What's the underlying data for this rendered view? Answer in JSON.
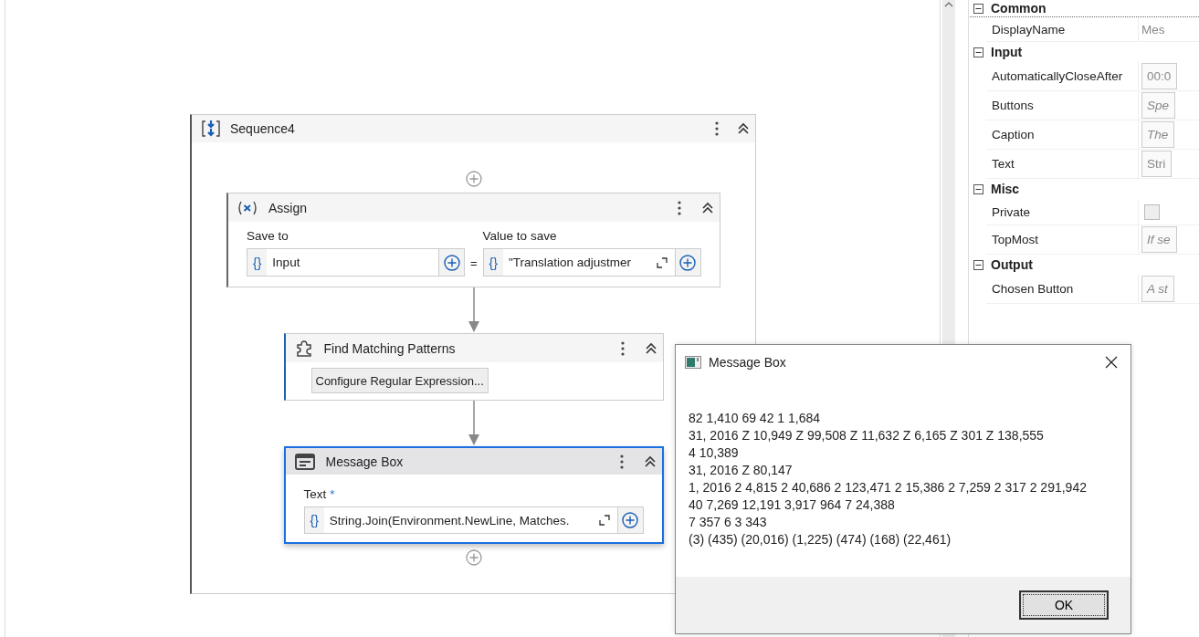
{
  "sequence": {
    "title": "Sequence4",
    "activities": [
      {
        "kind": "assign",
        "title": "Assign",
        "selected": false,
        "save_to_label": "Save to",
        "save_to_brace": "{}",
        "save_to_value": "Input",
        "equals": "=",
        "value_label": "Value to save",
        "value_brace": "{}",
        "value": "\"Translation adjustmer"
      },
      {
        "kind": "find",
        "title": "Find Matching Patterns",
        "selected": false,
        "button": "Configure Regular Expression..."
      },
      {
        "kind": "message",
        "title": "Message Box",
        "selected": true,
        "field_label": "Text",
        "required": "*",
        "brace": "{}",
        "value": "String.Join(Environment.NewLine, Matches."
      }
    ]
  },
  "properties": [
    {
      "name": "Common",
      "expanded": true,
      "rows": [
        {
          "label": "DisplayName",
          "kind": "plain",
          "value": "Mes"
        }
      ]
    },
    {
      "name": "Input",
      "expanded": true,
      "rows": [
        {
          "label": "AutomaticallyCloseAfter",
          "kind": "value",
          "value": "00:0"
        },
        {
          "label": "Buttons",
          "kind": "hint",
          "placeholder": "Spe"
        },
        {
          "label": "Caption",
          "kind": "hint",
          "placeholder": "The"
        },
        {
          "label": "Text",
          "kind": "value",
          "value": "Stri"
        }
      ]
    },
    {
      "name": "Misc",
      "expanded": true,
      "rows": [
        {
          "label": "Private",
          "kind": "checkbox",
          "checked": false
        },
        {
          "label": "TopMost",
          "kind": "hint",
          "placeholder": "If se"
        }
      ]
    },
    {
      "name": "Output",
      "expanded": true,
      "rows": [
        {
          "label": "Chosen Button",
          "kind": "hint",
          "placeholder": "A st"
        }
      ]
    }
  ],
  "dialog": {
    "title": "Message Box",
    "lines": [
      "82 1,410 69 42 1 1,684",
      "31, 2016 Z 10,949 Z 99,508 Z 11,632 Z 6,165 Z 301 Z 138,555",
      "4 10,389",
      "31, 2016 Z 80,147",
      "1, 2016 2 4,815 2 40,686 2 123,471 2 15,386 2 7,259 2 317 2 291,942",
      "40 7,269 12,191 3,917 964 7 24,388",
      "7 357 6 3 343",
      "(3) (435) (20,016) (1,225) (474) (168) (22,461)"
    ],
    "button": "OK"
  }
}
